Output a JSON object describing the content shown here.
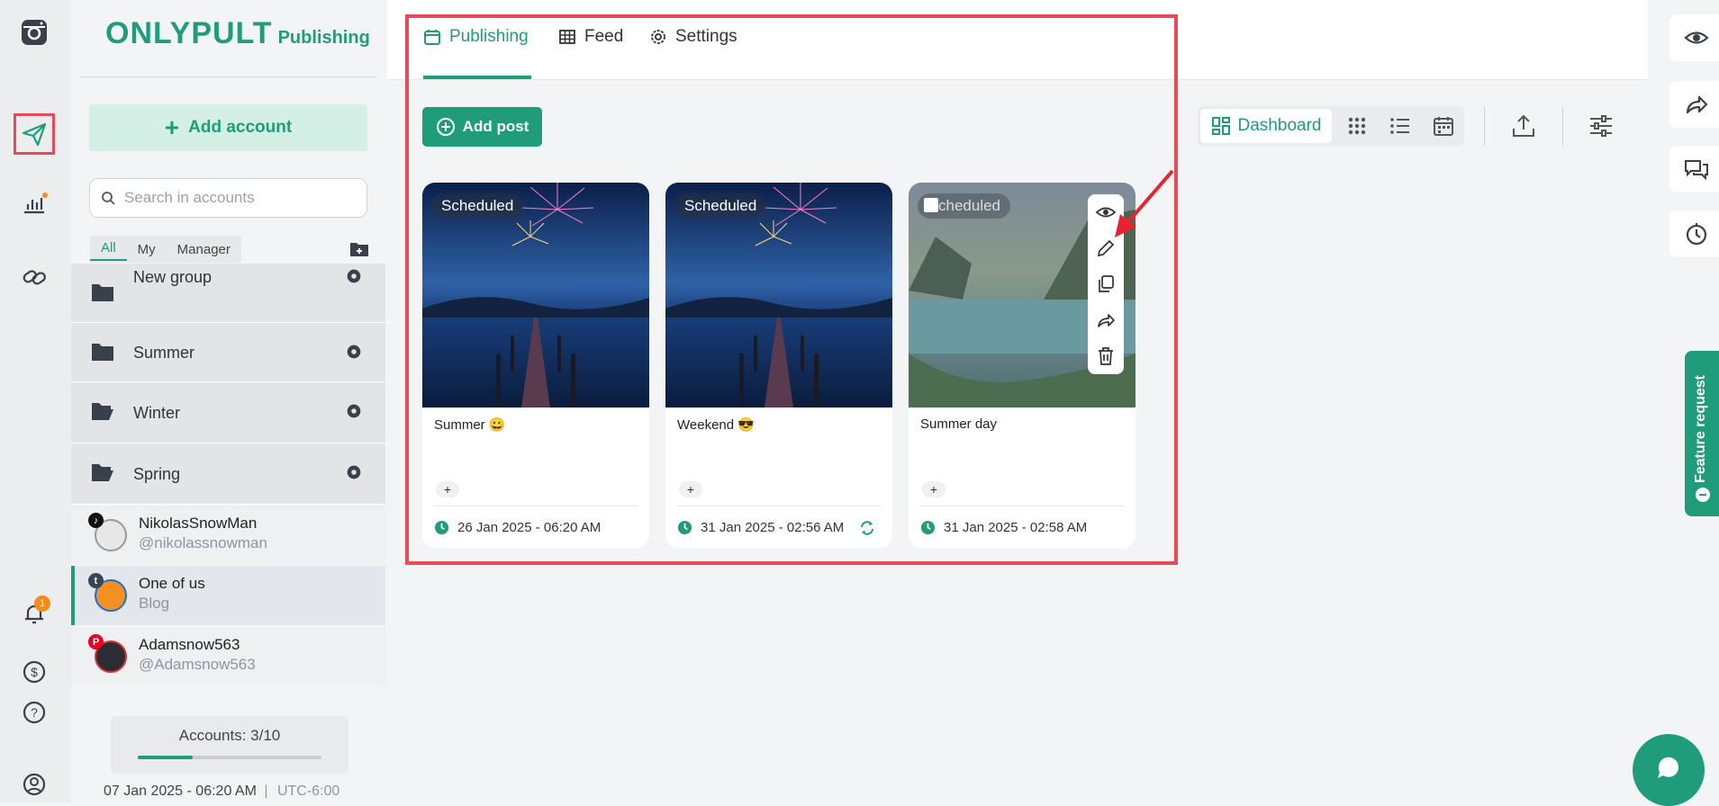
{
  "brand": {
    "name": "ONLYPULT",
    "product": "Publishing",
    "color": "#1f9d7a"
  },
  "left_rail": {
    "icons": [
      "instagram-icon",
      "send-icon",
      "analytics-icon",
      "link-icon",
      "bell-icon",
      "dollar-icon",
      "help-icon",
      "user-icon"
    ],
    "notification_count": "1"
  },
  "accounts_panel": {
    "add_account_label": "Add account",
    "search_placeholder": "Search in accounts",
    "filters": [
      "All",
      "My",
      "Manager"
    ],
    "groups": [
      {
        "label": "New group"
      },
      {
        "label": "Summer"
      },
      {
        "label": "Winter"
      },
      {
        "label": "Spring"
      }
    ],
    "accounts": [
      {
        "name": "NikolasSnowMan",
        "handle": "@nikolassnowman",
        "network": "tiktok"
      },
      {
        "name": "One of us",
        "handle": "Blog",
        "network": "tumblr"
      },
      {
        "name": "Adamsnow563",
        "handle": "@Adamsnow563",
        "network": "pinterest"
      }
    ],
    "accounts_count": "Accounts: 3/10",
    "accounts_usage": 0.3,
    "datetime": "07 Jan 2025 - 06:20 AM",
    "timezone": "UTC-6:00"
  },
  "tabs": [
    {
      "label": "Publishing",
      "active": true
    },
    {
      "label": "Feed",
      "active": false
    },
    {
      "label": "Settings",
      "active": false
    }
  ],
  "toolbar": {
    "add_post_label": "Add post",
    "view_dashboard_label": "Dashboard",
    "views": [
      "grid-view-icon",
      "list-view-icon",
      "calendar-view-icon"
    ],
    "actions": [
      "upload-icon",
      "filter-settings-icon"
    ]
  },
  "posts": [
    {
      "status": "Scheduled",
      "caption": "Summer 😀",
      "datetime": "26 Jan 2025 - 06:20 AM",
      "repeat": false
    },
    {
      "status": "Scheduled",
      "caption": "Weekend 😎",
      "datetime": "31 Jan 2025 - 02:56 AM",
      "repeat": true
    },
    {
      "status": "cheduled",
      "caption": "Summer day",
      "datetime": "31 Jan 2025 - 02:58 AM",
      "repeat": false
    }
  ],
  "post_actions": [
    "view-icon",
    "edit-icon",
    "copy-icon",
    "share-icon",
    "delete-icon"
  ],
  "right_rail": {
    "icons": [
      "eye-icon",
      "share-icon",
      "comments-icon",
      "history-icon"
    ],
    "feature_request_label": "Feature request"
  }
}
